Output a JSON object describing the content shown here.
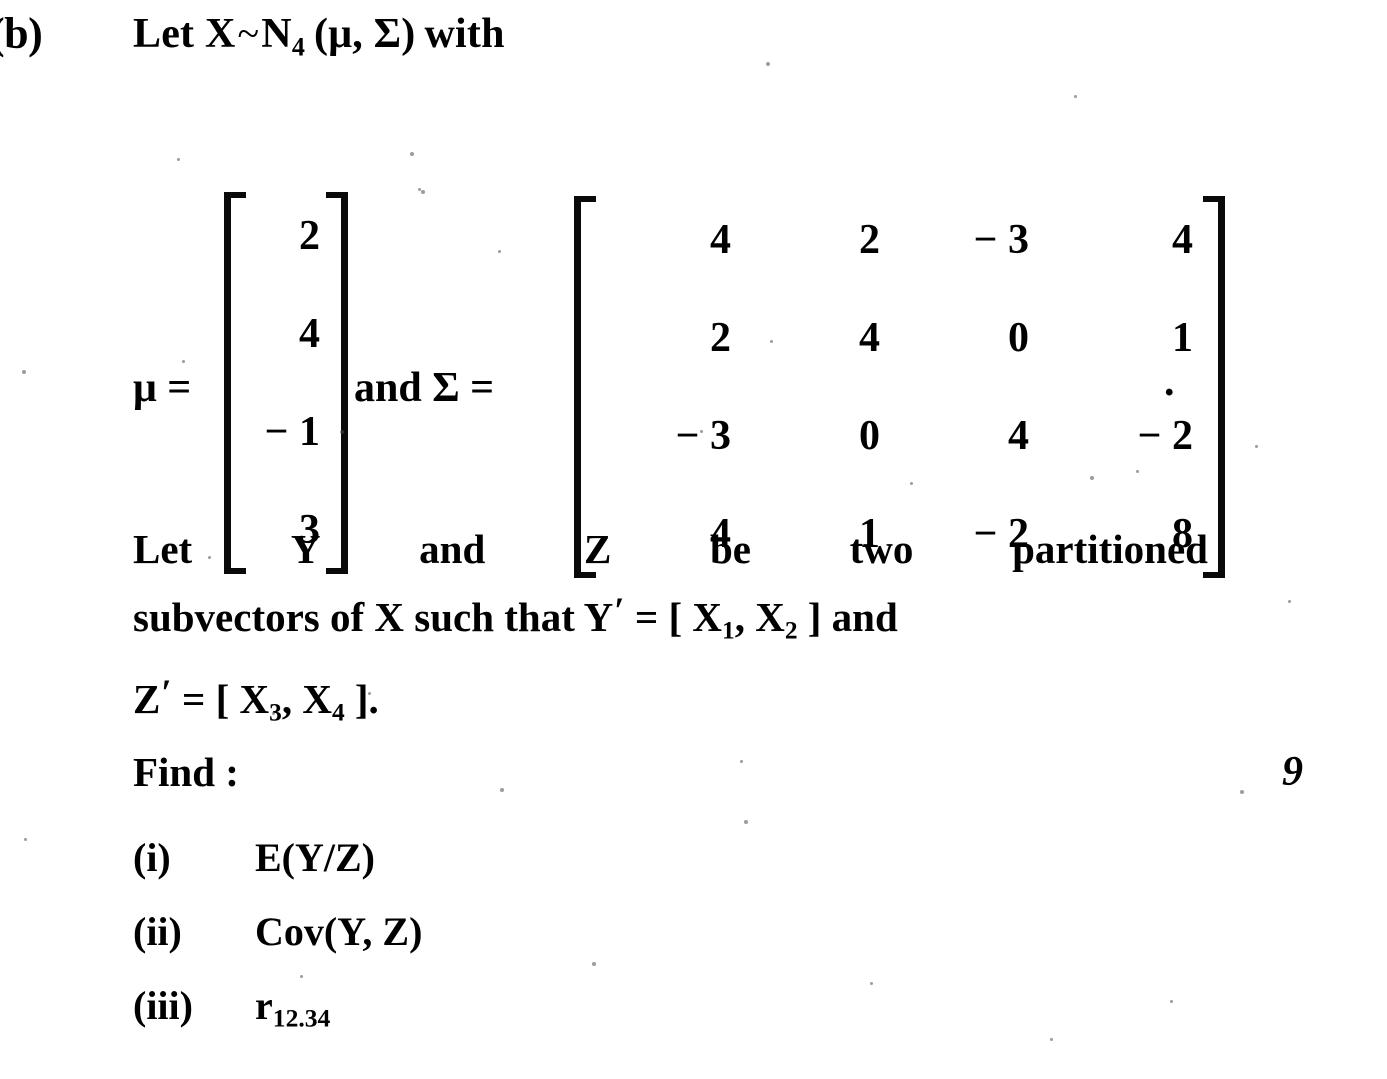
{
  "question": {
    "label": "(b)",
    "stem": {
      "prefix": "Let X",
      "tilde": "~",
      "dist": "N",
      "dist_sub": "4",
      "params": "(μ, Σ)",
      "suffix": "with",
      "full_text": "Let X ~ N4 (μ, Σ) with"
    },
    "marks": "9"
  },
  "equation": {
    "mu_label": "μ =",
    "mu_vector": [
      "2",
      "4",
      "− 1",
      "3"
    ],
    "connector": "and Σ =",
    "sigma_matrix": [
      [
        "4",
        "2",
        "− 3",
        "4"
      ],
      [
        "2",
        "4",
        "0",
        "1"
      ],
      [
        "− 3",
        "0",
        "4",
        "− 2"
      ],
      [
        "4",
        "1",
        "− 2",
        "8"
      ]
    ],
    "trailing_period": "."
  },
  "paragraph": {
    "line1_words": [
      "Let",
      "Y",
      "and",
      "Z",
      "be",
      "two",
      "partitioned"
    ],
    "line2": {
      "before": "subvectors of X such that Y",
      "prime": "′",
      "eq": "= [ X",
      "sub1": "1",
      "mid": ", X",
      "sub2": "2",
      "after": "] and"
    },
    "line3": {
      "var": "Z",
      "prime": "′",
      "eq": "= [ X",
      "sub1": "3",
      "mid": ", X",
      "sub2": "4",
      "after": "]."
    },
    "full_text": "Let Y and Z be two partitioned subvectors of X such that Y′ = [ X1, X2 ] and Z′ = [ X3, X4 ]."
  },
  "find": {
    "label": "Find :",
    "items": [
      {
        "num": "(i)",
        "text": "E(Y/Z)",
        "sub": ""
      },
      {
        "num": "(ii)",
        "text": "Cov(Y, Z)",
        "sub": ""
      },
      {
        "num": "(iii)",
        "text": "r",
        "sub": "12.34"
      }
    ]
  },
  "style": {
    "ink_color": "#000000",
    "page_color": "#ffffff"
  }
}
